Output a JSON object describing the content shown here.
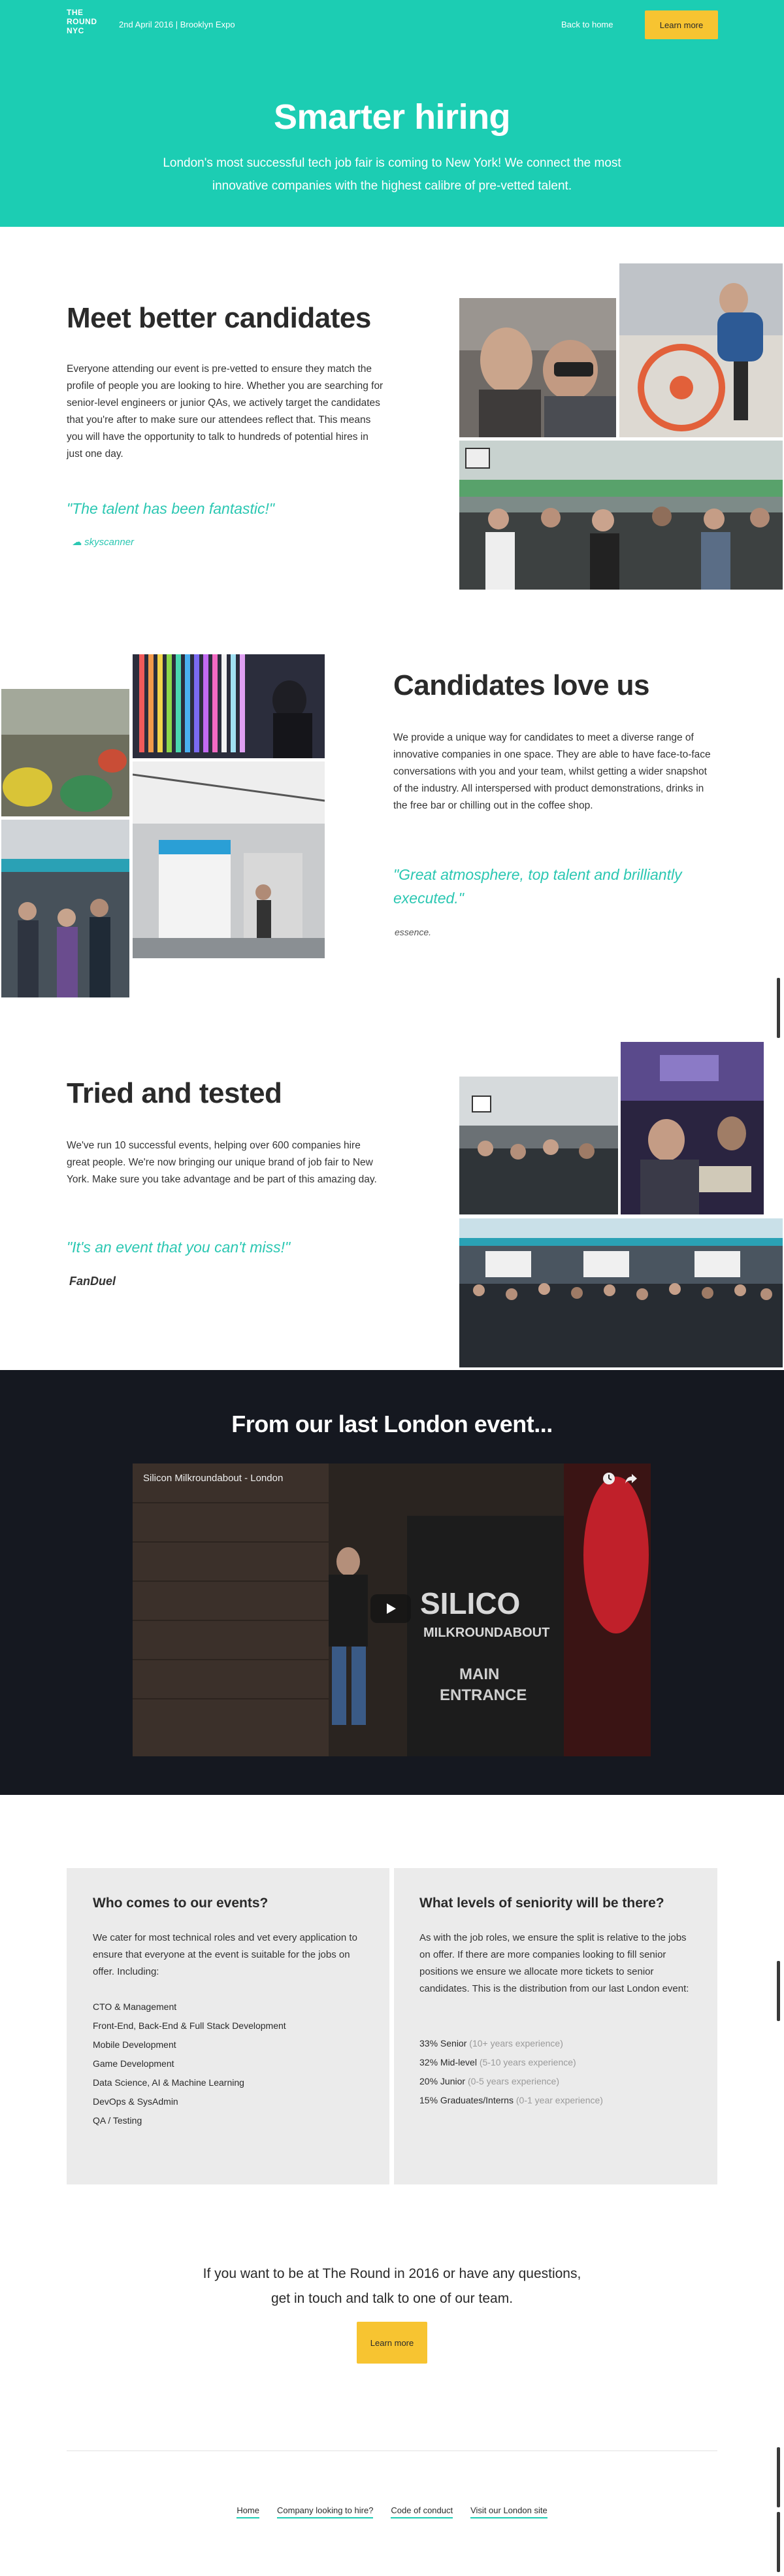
{
  "header": {
    "logo_line1": "THE",
    "logo_line2": "ROUND",
    "logo_line3": "NYC",
    "event_info": "2nd April 2016 | Brooklyn Expo",
    "back_home": "Back to home",
    "learn_more": "Learn more"
  },
  "hero": {
    "title": "Smarter hiring",
    "subtitle": "London's most successful tech job fair is coming to New York! We connect the most innovative companies with the highest calibre of pre-vetted talent."
  },
  "sections": [
    {
      "title": "Meet better candidates",
      "body": "Everyone attending our event is pre-vetted to ensure they match the profile of people you are looking to hire. Whether you are searching for senior-level engineers or junior QAs, we actively target the candidates that you're after to make sure our attendees reflect that. This means you will have the opportunity to talk to hundreds of potential hires in just one day.",
      "quote": "\"The talent has been fantastic!\"",
      "client": "skyscanner"
    },
    {
      "title": "Candidates love us",
      "body": "We provide a unique way for candidates to meet a diverse range of innovative companies in one space. They are able to have face-to-face conversations with you and your team, whilst getting a wider snapshot of the industry. All interspersed with product demonstrations, drinks in the free bar or chilling out in the coffee shop.",
      "quote": "\"Great atmosphere, top talent and brilliantly executed.\"",
      "client": "essence."
    },
    {
      "title": "Tried and tested",
      "body": "We've run 10 successful events, helping over 600 companies hire great people. We're now bringing our unique brand of job fair to New York. Make sure you take advantage and be part of this amazing day.",
      "quote": "\"It's an event that you can't miss!\"",
      "client": "FanDuel"
    }
  ],
  "video": {
    "heading": "From our last London event...",
    "name": "Silicon Milkroundabout - London"
  },
  "boxes": {
    "left": {
      "title": "Who comes to our events?",
      "body": "We cater for most technical roles and vet every application to ensure that everyone at the event is suitable for the jobs on offer. Including:",
      "items": [
        "CTO & Management",
        "Front-End, Back-End & Full Stack Development",
        "Mobile Development",
        "Game Development",
        "Data Science, AI & Machine Learning",
        "DevOps & SysAdmin",
        "QA / Testing"
      ]
    },
    "right": {
      "title": "What levels of seniority will be there?",
      "body": "As with the job roles, we ensure the split is relative to the jobs on offer. If there are more companies looking to fill senior positions we ensure we allocate more tickets to senior candidates. This is the distribution from our last London event:",
      "levels": [
        {
          "label": "33% Senior",
          "note": "(10+ years experience)"
        },
        {
          "label": "32% Mid-level",
          "note": "(5-10 years experience)"
        },
        {
          "label": "20% Junior",
          "note": "(0-5 years experience)"
        },
        {
          "label": "15% Graduates/Interns",
          "note": "(0-1 year experience)"
        }
      ]
    }
  },
  "cta": {
    "text": "If you want to be at The Round in 2016 or have any questions, get in touch and talk to one of our team.",
    "button": "Learn more"
  },
  "footer": {
    "links": [
      "Home",
      "Company looking to hire?",
      "Code of conduct",
      "Visit our London site"
    ]
  },
  "colors": {
    "brand_teal": "#1ccdb3",
    "button_yellow": "#f7c431",
    "dark_bg": "#151820"
  }
}
